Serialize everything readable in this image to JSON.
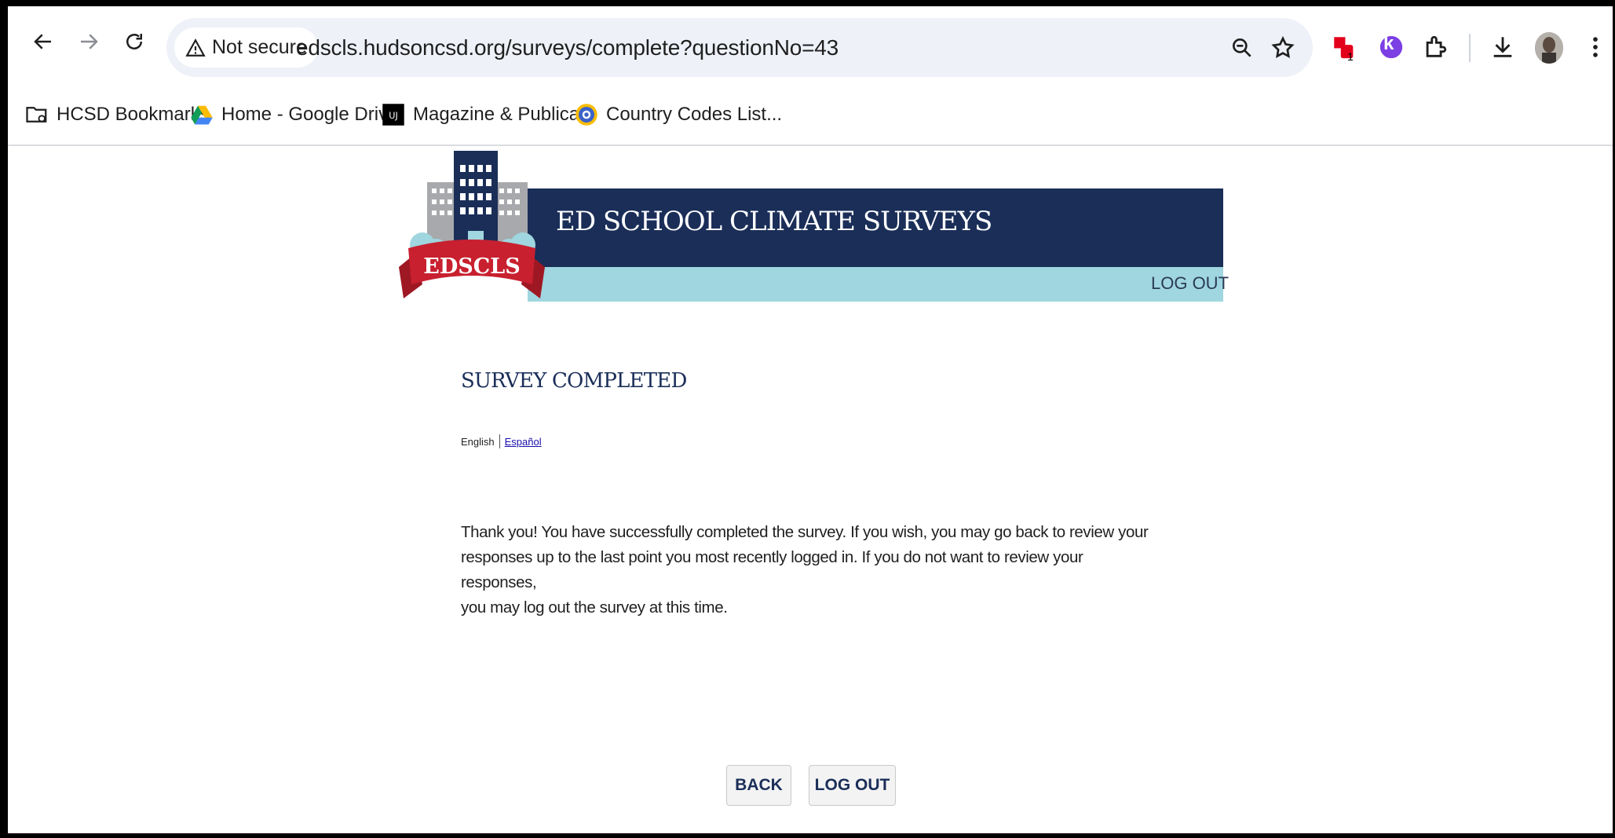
{
  "browser": {
    "security_label": "Not secure",
    "url": "edscls.hudsoncsd.org/surveys/complete?questionNo=43",
    "extension_badge": "1",
    "extension_letter": "k",
    "icons": [
      "back-arrow-icon",
      "forward-arrow-icon",
      "reload-icon",
      "warning-icon",
      "zoom-icon",
      "star-icon",
      "extension-icon",
      "k-extension-icon",
      "puzzle-icon",
      "download-icon",
      "avatar",
      "more-vert-icon"
    ]
  },
  "bookmarks": [
    {
      "label": "HCSD Bookmarks",
      "icon": "folder-icon"
    },
    {
      "label": "Home - Google Drive",
      "icon": "google-drive-icon"
    },
    {
      "label": "Magazine & Publica...",
      "icon": "issuu-icon"
    },
    {
      "label": "Country Codes List...",
      "icon": "at-icon"
    }
  ],
  "header": {
    "title": "ED SCHOOL CLIMATE SURVEYS",
    "logo_text": "EDSCLS",
    "logout": "LOG OUT",
    "colors": {
      "navy": "#1a2e58",
      "light_blue": "#9fd6df",
      "ribbon_red": "#c8202f"
    }
  },
  "content": {
    "heading": "SURVEY COMPLETED",
    "lang_english": "English",
    "lang_espanol": "Español",
    "message_lines": [
      "Thank you! You have successfully completed the survey. If you wish, you may go back to review your",
      "responses up to the last point you most recently logged in. If you do not want to review your responses,",
      "you may log out the survey at this time."
    ]
  },
  "buttons": {
    "back": "BACK",
    "logout": "LOG OUT"
  }
}
